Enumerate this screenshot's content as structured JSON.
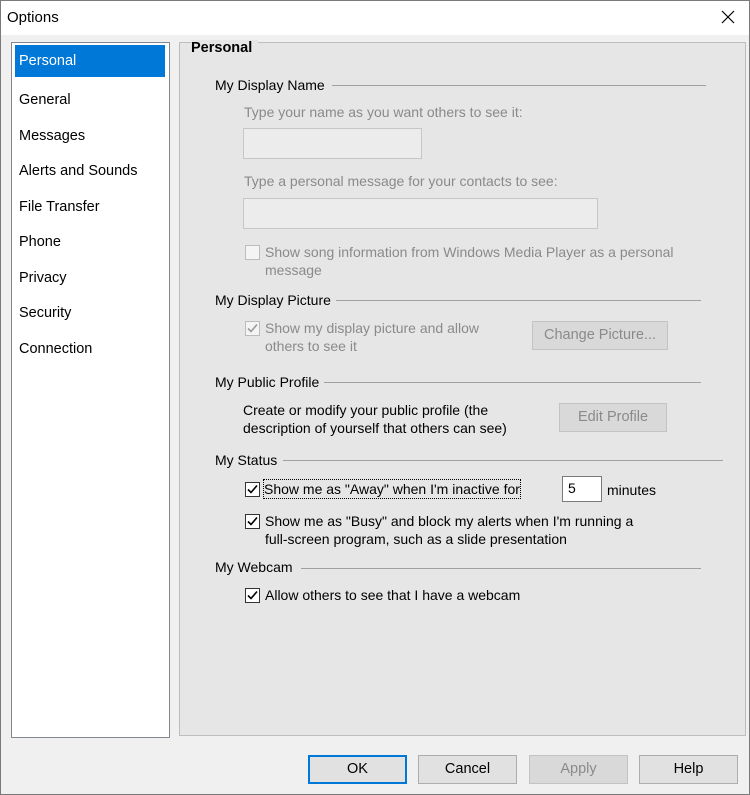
{
  "window": {
    "title": "Options"
  },
  "sidebar": {
    "items": [
      {
        "label": "Personal",
        "selected": true
      },
      {
        "label": "General"
      },
      {
        "label": "Messages"
      },
      {
        "label": "Alerts and Sounds"
      },
      {
        "label": "File Transfer"
      },
      {
        "label": "Phone"
      },
      {
        "label": "Privacy"
      },
      {
        "label": "Security"
      },
      {
        "label": "Connection"
      }
    ]
  },
  "panel": {
    "title": "Personal"
  },
  "display_name": {
    "group": "My Display Name",
    "name_prompt": "Type your name as you want others to see it:",
    "name_value": "",
    "message_prompt": "Type a personal message for your contacts to see:",
    "message_value": "",
    "song_checkbox_label_line1": "Show song information from Windows Media Player as a personal",
    "song_checkbox_label_line2": "message",
    "song_checked": false
  },
  "display_picture": {
    "group": "My Display Picture",
    "show_label_line1": "Show my display picture and allow",
    "show_label_line2": "others to see it",
    "show_checked": true,
    "change_button": "Change Picture..."
  },
  "public_profile": {
    "group": "My Public Profile",
    "desc_line1": "Create or modify your public profile (the",
    "desc_line2": "description of yourself that others can see)",
    "edit_button": "Edit Profile"
  },
  "status": {
    "group": "My Status",
    "away_label": "Show me as \"Away\" when I'm inactive for",
    "away_checked": true,
    "away_minutes": "5",
    "minutes_label": "minutes",
    "busy_label_line1": "Show me as \"Busy\" and block my alerts when I'm running a",
    "busy_label_line2": "full-screen program, such as a slide presentation",
    "busy_checked": true
  },
  "webcam": {
    "group": "My Webcam",
    "allow_label": "Allow others to see that I have a webcam",
    "allow_checked": true
  },
  "footer": {
    "ok": "OK",
    "cancel": "Cancel",
    "apply": "Apply",
    "help": "Help"
  }
}
